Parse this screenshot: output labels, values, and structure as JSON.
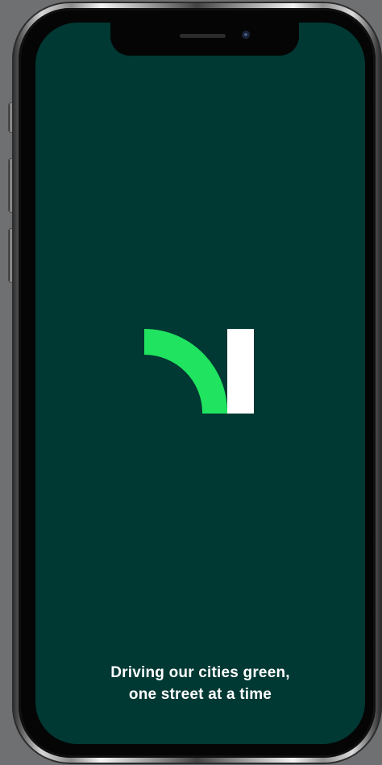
{
  "device": {
    "name": "phone-mockup",
    "screen_color": "#003833"
  },
  "splash": {
    "logo": {
      "green": "#20e35f",
      "white": "#ffffff"
    },
    "tagline_line_1": "Driving our cities green,",
    "tagline_line_2": "one street at a time"
  }
}
